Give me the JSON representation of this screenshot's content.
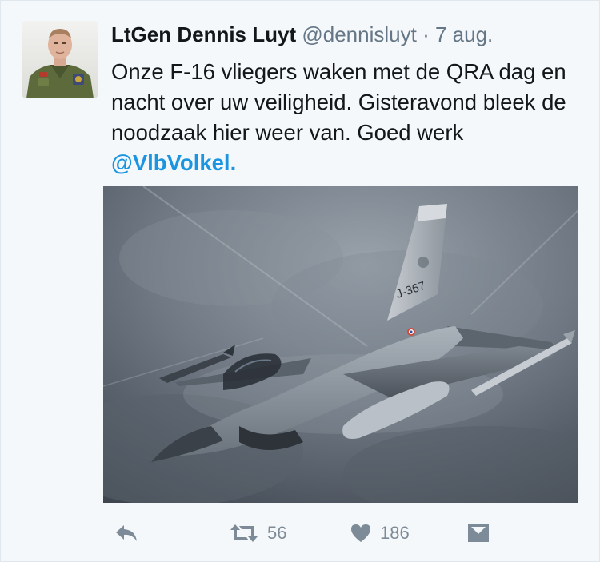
{
  "tweet": {
    "author_name": "LtGen Dennis Luyt",
    "author_handle": "@dennisluyt",
    "separator": "·",
    "date": "7 aug.",
    "text_plain": "Onze F-16 vliegers waken met de QRA dag en nacht over uw veiligheid. Gisteravond bleek de noodzaak hier weer van. Goed werk ",
    "mention": "@VlbVolkel.",
    "image": {
      "tail_code": "J-367"
    }
  },
  "actions": {
    "reply_icon": "reply-icon",
    "retweet_icon": "retweet-icon",
    "retweet_count": "56",
    "like_icon": "heart-icon",
    "like_count": "186",
    "dm_icon": "direct-message-icon"
  },
  "colors": {
    "link": "#1b95e0",
    "muted": "#657786",
    "action_icon": "#7d8b98",
    "background": "#f5f8fa"
  }
}
